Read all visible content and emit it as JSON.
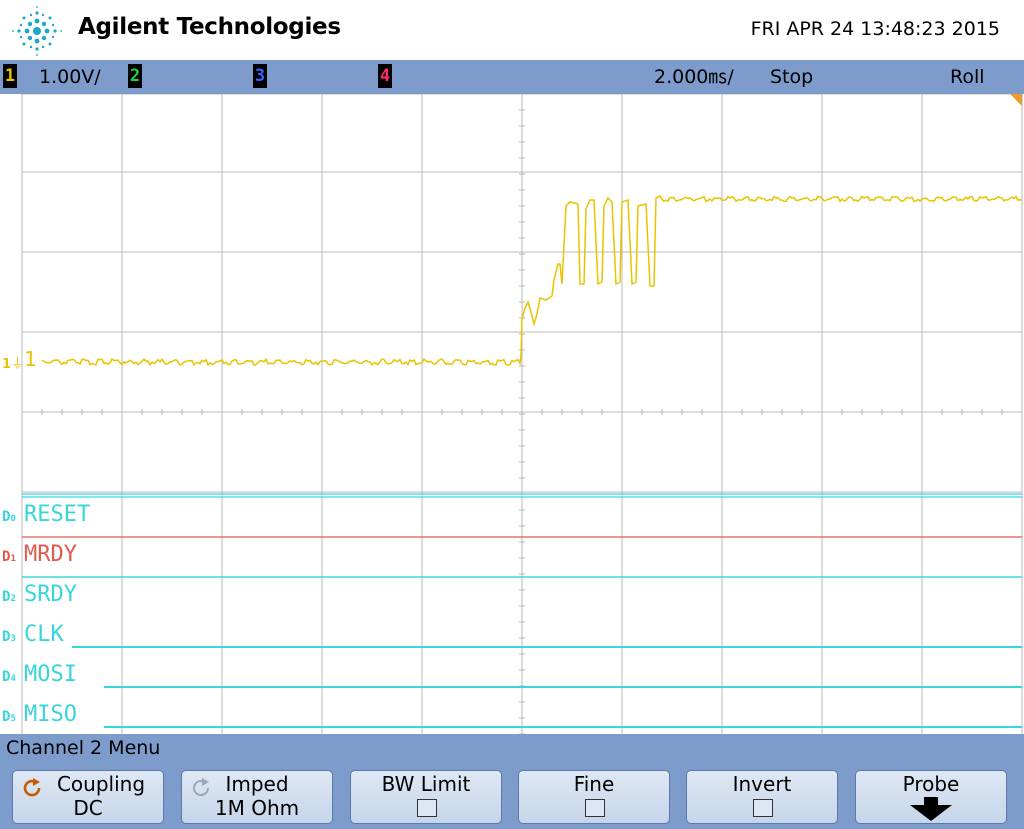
{
  "header": {
    "brand": "Agilent Technologies",
    "datetime": "FRI APR 24 13:48:23 2015"
  },
  "status": {
    "ch1_num": "1",
    "ch1_scale": "1.00V/",
    "ch2_num": "2",
    "ch3_num": "3",
    "ch4_num": "4",
    "timebase": "2.000㎳/",
    "run_state": "Stop",
    "mode": "Roll"
  },
  "colors": {
    "ch1": "#e8c400",
    "ch2": "#1fd03a",
    "ch3": "#3a63ff",
    "ch4": "#ff2a6d",
    "digital": "#37d6dd",
    "mrdy": "#e05a4e",
    "bar": "#7d9ccc"
  },
  "screen": {
    "ch1_marker": "1",
    "digital": [
      {
        "index": "0",
        "name": "RESET"
      },
      {
        "index": "1",
        "name": "MRDY"
      },
      {
        "index": "2",
        "name": "SRDY"
      },
      {
        "index": "3",
        "name": "CLK"
      },
      {
        "index": "4",
        "name": "MOSI"
      },
      {
        "index": "5",
        "name": "MISO"
      }
    ]
  },
  "menu": {
    "title": "Channel 2  Menu",
    "softkeys": [
      {
        "label": "Coupling",
        "value": "DC",
        "icon": "rotate-arrow-icon"
      },
      {
        "label": "Imped",
        "value": "1M Ohm",
        "icon": "rotate-arrow-icon"
      },
      {
        "label": "BW Limit",
        "checked": false
      },
      {
        "label": "Fine",
        "checked": false
      },
      {
        "label": "Invert",
        "checked": false
      },
      {
        "label": "Probe",
        "icon": "down-arrow-icon"
      }
    ]
  }
}
